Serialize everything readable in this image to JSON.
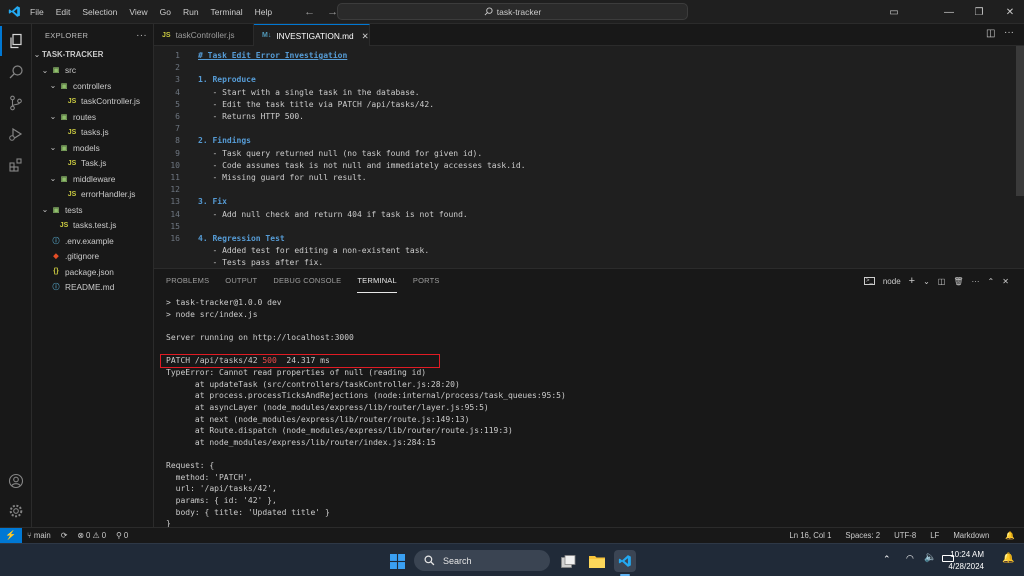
{
  "titlebar": {
    "menus": [
      "File",
      "Edit",
      "Selection",
      "View",
      "Go",
      "Run",
      "Terminal",
      "Help"
    ],
    "search_text": "task-tracker"
  },
  "sidebar": {
    "header": "EXPLORER",
    "project": "TASK-TRACKER",
    "items": [
      {
        "label": "src",
        "icon": "folder-icon",
        "depth": 1,
        "expanded": true
      },
      {
        "label": "controllers",
        "icon": "folder-icon",
        "depth": 2,
        "expanded": true
      },
      {
        "label": "taskController.js",
        "icon": "js-file-icon",
        "depth": 3
      },
      {
        "label": "routes",
        "icon": "folder-icon",
        "depth": 2,
        "expanded": true
      },
      {
        "label": "tasks.js",
        "icon": "js-file-icon",
        "depth": 3
      },
      {
        "label": "models",
        "icon": "folder-icon",
        "depth": 2,
        "expanded": true
      },
      {
        "label": "Task.js",
        "icon": "js-file-icon",
        "depth": 3
      },
      {
        "label": "middleware",
        "icon": "folder-icon",
        "depth": 2,
        "expanded": true
      },
      {
        "label": "errorHandler.js",
        "icon": "js-file-icon",
        "depth": 3
      },
      {
        "label": "tests",
        "icon": "folder-icon",
        "depth": 1,
        "expanded": true
      },
      {
        "label": "tasks.test.js",
        "icon": "js-file-icon",
        "depth": 2
      },
      {
        "label": ".env.example",
        "icon": "info-file-icon",
        "depth": 1
      },
      {
        "label": ".gitignore",
        "icon": "git-file-icon",
        "depth": 1
      },
      {
        "label": "package.json",
        "icon": "json-file-icon",
        "depth": 1
      },
      {
        "label": "README.md",
        "icon": "info-file-icon",
        "depth": 1
      }
    ]
  },
  "tabs": [
    {
      "label": "taskController.js",
      "icon": "JS",
      "active": false
    },
    {
      "label": "INVESTIGATION.md",
      "icon": "M↓",
      "active": true
    }
  ],
  "editor": {
    "lines": [
      {
        "n": "1",
        "text": "# Task Edit Error Investigation",
        "kind": "h1"
      },
      {
        "n": "2",
        "text": "",
        "kind": "text"
      },
      {
        "n": "3",
        "text": "1. Reproduce",
        "kind": "h"
      },
      {
        "n": "4",
        "text": "   - Start with a single task in the database.",
        "kind": "text"
      },
      {
        "n": "5",
        "text": "   - Edit the task title via PATCH /api/tasks/42.",
        "kind": "text"
      },
      {
        "n": "6",
        "text": "   - Returns HTTP 500.",
        "kind": "text"
      },
      {
        "n": "7",
        "text": "",
        "kind": "text"
      },
      {
        "n": "8",
        "text": "2. Findings",
        "kind": "h"
      },
      {
        "n": "9",
        "text": "   - Task query returned null (no task found for given id).",
        "kind": "text"
      },
      {
        "n": "10",
        "text": "   - Code assumes task is not null and immediately accesses task.id.",
        "kind": "text"
      },
      {
        "n": "11",
        "text": "   - Missing guard for null result.",
        "kind": "text"
      },
      {
        "n": "12",
        "text": "",
        "kind": "text"
      },
      {
        "n": "13",
        "text": "3. Fix",
        "kind": "h"
      },
      {
        "n": "14",
        "text": "   - Add null check and return 404 if task is not found.",
        "kind": "text"
      },
      {
        "n": "15",
        "text": "",
        "kind": "text"
      },
      {
        "n": "16",
        "text": "4. Regression Test",
        "kind": "h"
      },
      {
        "n": "",
        "text": "   - Added test for editing a non-existent task.",
        "kind": "text"
      },
      {
        "n": "",
        "text": "   - Tests pass after fix.",
        "kind": "text"
      }
    ]
  },
  "panel": {
    "tabs": [
      "PROBLEMS",
      "OUTPUT",
      "DEBUG CONSOLE",
      "TERMINAL",
      "PORTS"
    ],
    "active_tab": "TERMINAL",
    "terminal_name": "node",
    "lines": [
      {
        "text": "> task-tracker@1.0.0 dev"
      },
      {
        "text": "> node src/index.js"
      },
      {
        "text": ""
      },
      {
        "text": "Server running on http://localhost:3000"
      },
      {
        "text": ""
      },
      {
        "text": "PATCH /api/tasks/42 ",
        "status": "500",
        "tail": "  24.317 ms"
      },
      {
        "text": "TypeError: Cannot read properties of null (reading id)",
        "highlight": true
      },
      {
        "text": "      at updateTask (src/controllers/taskController.js:28:20)"
      },
      {
        "text": "      at process.processTicksAndRejections (node:internal/process/task_queues:95:5)"
      },
      {
        "text": "      at asyncLayer (node_modules/express/lib/router/layer.js:95:5)"
      },
      {
        "text": "      at next (node_modules/express/lib/router/route.js:149:13)"
      },
      {
        "text": "      at Route.dispatch (node_modules/express/lib/router/route.js:119:3)"
      },
      {
        "text": "      at node_modules/express/lib/router/index.js:284:15"
      },
      {
        "text": ""
      },
      {
        "text": "Request: {"
      },
      {
        "text": "  method: 'PATCH',"
      },
      {
        "text": "  url: '/api/tasks/42',"
      },
      {
        "text": "  params: { id: '42' },"
      },
      {
        "text": "  body: { title: 'Updated title' }"
      },
      {
        "text": "}"
      }
    ]
  },
  "statusbar": {
    "branch": "main",
    "errors": "0",
    "warnings": "0",
    "ports": "0",
    "position": "Ln 16, Col 1",
    "spaces": "Spaces: 2",
    "encoding": "UTF-8",
    "eol": "LF",
    "language": "Markdown"
  },
  "taskbar": {
    "search_label": "Search",
    "time": "10:24 AM",
    "date": "4/28/2024"
  },
  "colors": {
    "accent": "#0078d4",
    "error": "#f14c4c",
    "highlight_box": "#e01b24"
  }
}
